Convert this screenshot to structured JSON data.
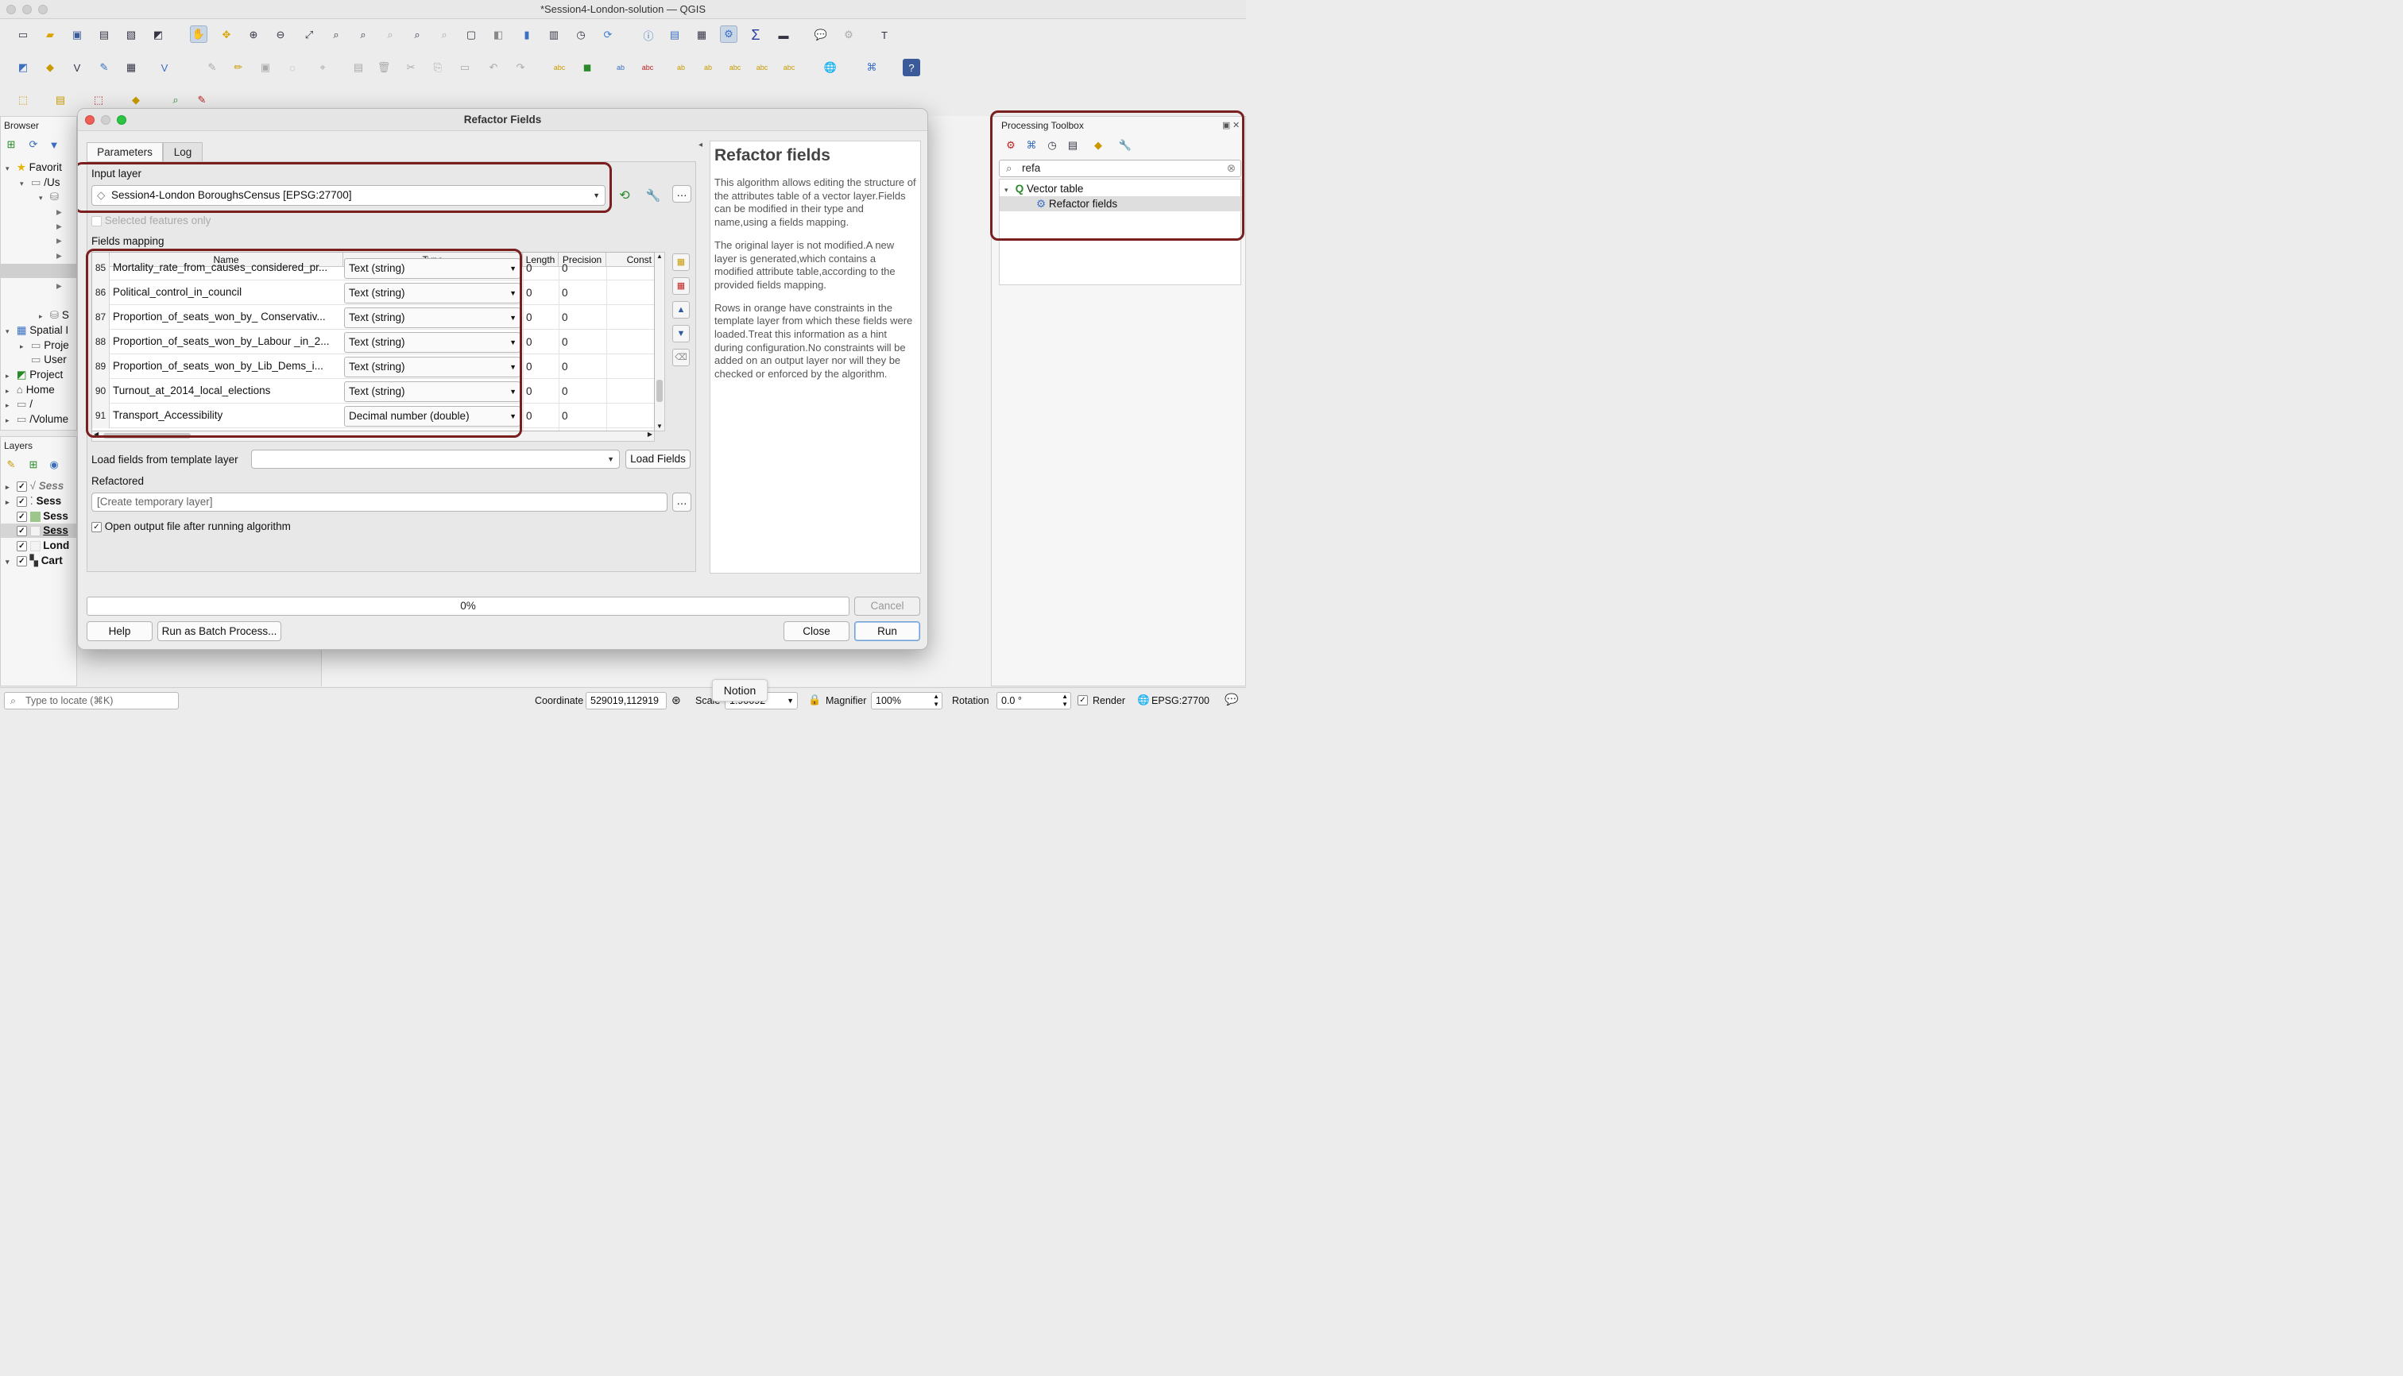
{
  "window": {
    "title": "*Session4-London-solution — QGIS"
  },
  "browser": {
    "title": "Browser",
    "items": [
      {
        "label": "Favorit",
        "arrow": "▾"
      },
      {
        "label": "/Us",
        "arrow": "▾"
      },
      {
        "label": "",
        "arrow": "▾"
      },
      {
        "label": "S",
        "arrow": "▸"
      },
      {
        "label": "Spatial I",
        "arrow": "▾"
      },
      {
        "label": "Proje",
        "arrow": "▸"
      },
      {
        "label": "User",
        "arrow": ""
      },
      {
        "label": "Project",
        "arrow": "▸"
      },
      {
        "label": "Home",
        "arrow": "▸"
      },
      {
        "label": "/",
        "arrow": "▸"
      },
      {
        "label": "/Volume",
        "arrow": "▸"
      }
    ]
  },
  "layers": {
    "title": "Layers",
    "items": [
      {
        "label": "Sess"
      },
      {
        "label": "Sess"
      },
      {
        "label": "Sess"
      },
      {
        "label": "Sess"
      },
      {
        "label": "Lond"
      },
      {
        "label": "Cart"
      }
    ]
  },
  "dialog": {
    "title": "Refactor Fields",
    "tabs": [
      "Parameters",
      "Log"
    ],
    "input_layer_label": "Input layer",
    "input_layer_value": "Session4-London BoroughsCensus [EPSG:27700]",
    "selected_only_label": "Selected features only",
    "fields_mapping_label": "Fields mapping",
    "columns": [
      "Name",
      "Type",
      "Length",
      "Precision",
      "Const"
    ],
    "rows": [
      {
        "num": "85",
        "name": "Mortality_rate_from_causes_considered_pr...",
        "type": "Text (string)",
        "length": "0",
        "precision": "0"
      },
      {
        "num": "86",
        "name": "Political_control_in_council",
        "type": "Text (string)",
        "length": "0",
        "precision": "0"
      },
      {
        "num": "87",
        "name": "Proportion_of_seats_won_by_ Conservativ...",
        "type": "Text (string)",
        "length": "0",
        "precision": "0"
      },
      {
        "num": "88",
        "name": "Proportion_of_seats_won_by_Labour _in_2...",
        "type": "Text (string)",
        "length": "0",
        "precision": "0"
      },
      {
        "num": "89",
        "name": "Proportion_of_seats_won_by_Lib_Dems_i...",
        "type": "Text (string)",
        "length": "0",
        "precision": "0"
      },
      {
        "num": "90",
        "name": "Turnout_at_2014_local_elections",
        "type": "Text (string)",
        "length": "0",
        "precision": "0"
      },
      {
        "num": "91",
        "name": "Transport_Accessibility",
        "type": "Decimal number (double)",
        "length": "0",
        "precision": "0"
      }
    ],
    "template_label": "Load fields from template layer",
    "template_value": "",
    "load_fields_button": "Load Fields",
    "refactored_label": "Refactored",
    "refactored_placeholder": "[Create temporary layer]",
    "open_output_label": "Open output file after running algorithm",
    "open_output_checked": "✓",
    "progress_text": "0%",
    "progress_value": 0,
    "cancel_button": "Cancel",
    "help_button": "Help",
    "batch_button": "Run as Batch Process...",
    "close_button": "Close",
    "run_button": "Run",
    "browse_button": "…"
  },
  "help_panel": {
    "heading": "Refactor fields",
    "paragraphs": [
      "This algorithm allows editing the structure of the attributes table of a vector layer.Fields can be modified in their type and name,using a fields mapping.",
      "The original layer is not modified.A new layer is generated,which contains a modified attribute table,according to the provided fields mapping.",
      "Rows in orange have constraints in the template layer from which these fields were loaded.Treat this information as a hint during configuration.No constraints will be added on an output layer nor will they be checked or enforced by the algorithm."
    ]
  },
  "toolbox": {
    "title": "Processing Toolbox",
    "search_value": "refa",
    "group": "Vector table",
    "item": "Refactor fields"
  },
  "statusbar": {
    "locate_placeholder": "Type to locate (⌘K)",
    "coordinate_label": "Coordinate",
    "coordinate_value": "529019,112919",
    "scale_label": "Scale",
    "scale_value": "1:90092",
    "magnifier_label": "Magnifier",
    "magnifier_value": "100%",
    "rotation_label": "Rotation",
    "rotation_value": "0.0 °",
    "render_label": "Render",
    "crs": "EPSG:27700",
    "tooltip": "Notion"
  },
  "colors": {
    "highlight": "#7a1f1f",
    "accent": "#6e9fd6"
  }
}
